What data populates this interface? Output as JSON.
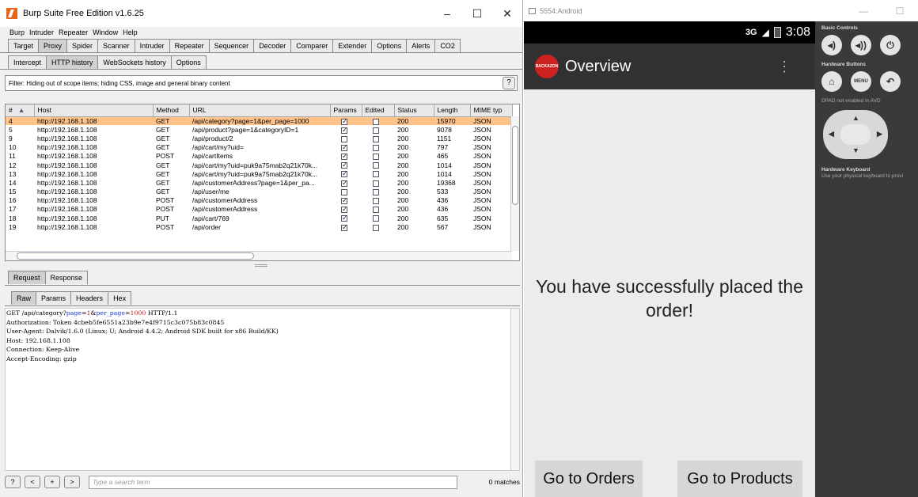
{
  "burp": {
    "window_title": "Burp Suite Free Edition v1.6.25",
    "window_controls": [
      "–",
      "☐",
      "✕"
    ],
    "menu": [
      "Burp",
      "Intruder",
      "Repeater",
      "Window",
      "Help"
    ],
    "main_tabs": [
      "Target",
      "Proxy",
      "Spider",
      "Scanner",
      "Intruder",
      "Repeater",
      "Sequencer",
      "Decoder",
      "Comparer",
      "Extender",
      "Options",
      "Alerts",
      "CO2"
    ],
    "active_main_tab": "Proxy",
    "proxy_tabs": [
      "Intercept",
      "HTTP history",
      "WebSockets history",
      "Options"
    ],
    "active_proxy_tab": "HTTP history",
    "filter_text": "Filter: Hiding out of scope items;  hiding CSS, image and general binary content",
    "help_label": "?",
    "columns": [
      "#",
      "Host",
      "Method",
      "URL",
      "Params",
      "Edited",
      "Status",
      "Length",
      "MIME typ"
    ],
    "sort_indicator": "▲",
    "rows": [
      {
        "num": "4",
        "host": "http://192.168.1.108",
        "method": "GET",
        "url": "/api/category?page=1&per_page=1000",
        "params": true,
        "edited": false,
        "status": "200",
        "length": "15970",
        "mime": "JSON",
        "selected": true
      },
      {
        "num": "5",
        "host": "http://192.168.1.108",
        "method": "GET",
        "url": "/api/product?page=1&categoryID=1",
        "params": true,
        "edited": false,
        "status": "200",
        "length": "9078",
        "mime": "JSON"
      },
      {
        "num": "9",
        "host": "http://192.168.1.108",
        "method": "GET",
        "url": "/api/product/2",
        "params": false,
        "edited": false,
        "status": "200",
        "length": "1151",
        "mime": "JSON"
      },
      {
        "num": "10",
        "host": "http://192.168.1.108",
        "method": "GET",
        "url": "/api/cart/my?uid=",
        "params": true,
        "edited": false,
        "status": "200",
        "length": "797",
        "mime": "JSON"
      },
      {
        "num": "11",
        "host": "http://192.168.1.108",
        "method": "POST",
        "url": "/api/cartItems",
        "params": true,
        "edited": false,
        "status": "200",
        "length": "465",
        "mime": "JSON"
      },
      {
        "num": "12",
        "host": "http://192.168.1.108",
        "method": "GET",
        "url": "/api/cart/my?uid=puk9a75mab2q21k70k...",
        "params": true,
        "edited": false,
        "status": "200",
        "length": "1014",
        "mime": "JSON"
      },
      {
        "num": "13",
        "host": "http://192.168.1.108",
        "method": "GET",
        "url": "/api/cart/my?uid=puk9a75mab2q21k70k...",
        "params": true,
        "edited": false,
        "status": "200",
        "length": "1014",
        "mime": "JSON"
      },
      {
        "num": "14",
        "host": "http://192.168.1.108",
        "method": "GET",
        "url": "/api/customerAddress?page=1&per_pa...",
        "params": true,
        "edited": false,
        "status": "200",
        "length": "19368",
        "mime": "JSON"
      },
      {
        "num": "15",
        "host": "http://192.168.1.108",
        "method": "GET",
        "url": "/api/user/me",
        "params": false,
        "edited": false,
        "status": "200",
        "length": "533",
        "mime": "JSON"
      },
      {
        "num": "16",
        "host": "http://192.168.1.108",
        "method": "POST",
        "url": "/api/customerAddress",
        "params": true,
        "edited": false,
        "status": "200",
        "length": "436",
        "mime": "JSON"
      },
      {
        "num": "17",
        "host": "http://192.168.1.108",
        "method": "POST",
        "url": "/api/customerAddress",
        "params": true,
        "edited": false,
        "status": "200",
        "length": "436",
        "mime": "JSON"
      },
      {
        "num": "18",
        "host": "http://192.168.1.108",
        "method": "PUT",
        "url": "/api/cart/769",
        "params": true,
        "edited": false,
        "status": "200",
        "length": "635",
        "mime": "JSON"
      },
      {
        "num": "19",
        "host": "http://192.168.1.108",
        "method": "POST",
        "url": "/api/order",
        "params": true,
        "edited": false,
        "status": "200",
        "length": "567",
        "mime": "JSON"
      }
    ],
    "rr_tabs": [
      "Request",
      "Response"
    ],
    "active_rr_tab": "Request",
    "view_tabs": [
      "Raw",
      "Params",
      "Headers",
      "Hex"
    ],
    "active_view_tab": "Raw",
    "request_line": {
      "prefix": "GET /api/category?",
      "p1_name": "page",
      "p1_eq": "=",
      "p1_val": "1",
      "amp": "&",
      "p2_name": "per_page",
      "p2_eq": "=",
      "p2_val": "1000",
      "suffix": " HTTP/1.1"
    },
    "request_headers": [
      "Authorization: Token 4cbeb5fe6551a23b9e7e4f9715c3c075b83c0845",
      "User-Agent: Dalvik/1.6.0 (Linux; U; Android 4.4.2; Android SDK built for x86 Build/KK)",
      "Host: 192.168.1.108",
      "Connection: Keep-Alive",
      "Accept-Encoding: gzip"
    ],
    "search_buttons": [
      "?",
      "<",
      "+",
      ">"
    ],
    "search_placeholder": "Type a search term",
    "matches": "0 matches"
  },
  "emulator": {
    "window_title": "5554:Android",
    "window_controls": [
      "—",
      "☐"
    ],
    "status_network": "3G",
    "status_time": "3:08",
    "app_logo_text": "BACKAZON",
    "app_title": "Overview",
    "overflow_icon": "⋮",
    "message": "You have successfully placed the order!",
    "button_orders": "Go to Orders",
    "button_products": "Go to Products",
    "controls": {
      "basic_label": "Basic Controls",
      "hardware_label": "Hardware Buttons",
      "menu_label": "MENU",
      "dpad_note": "DPAD not enabled in AVD",
      "keyboard_label": "Hardware Keyboard",
      "keyboard_hint": "Use your physical keyboard to provi"
    }
  },
  "colors": {
    "selected_row": "#ffc38a",
    "param_name": "#1a3cd0",
    "param_value": "#d02020",
    "logo_orange": "#e8641b",
    "action_bar": "#313131"
  }
}
